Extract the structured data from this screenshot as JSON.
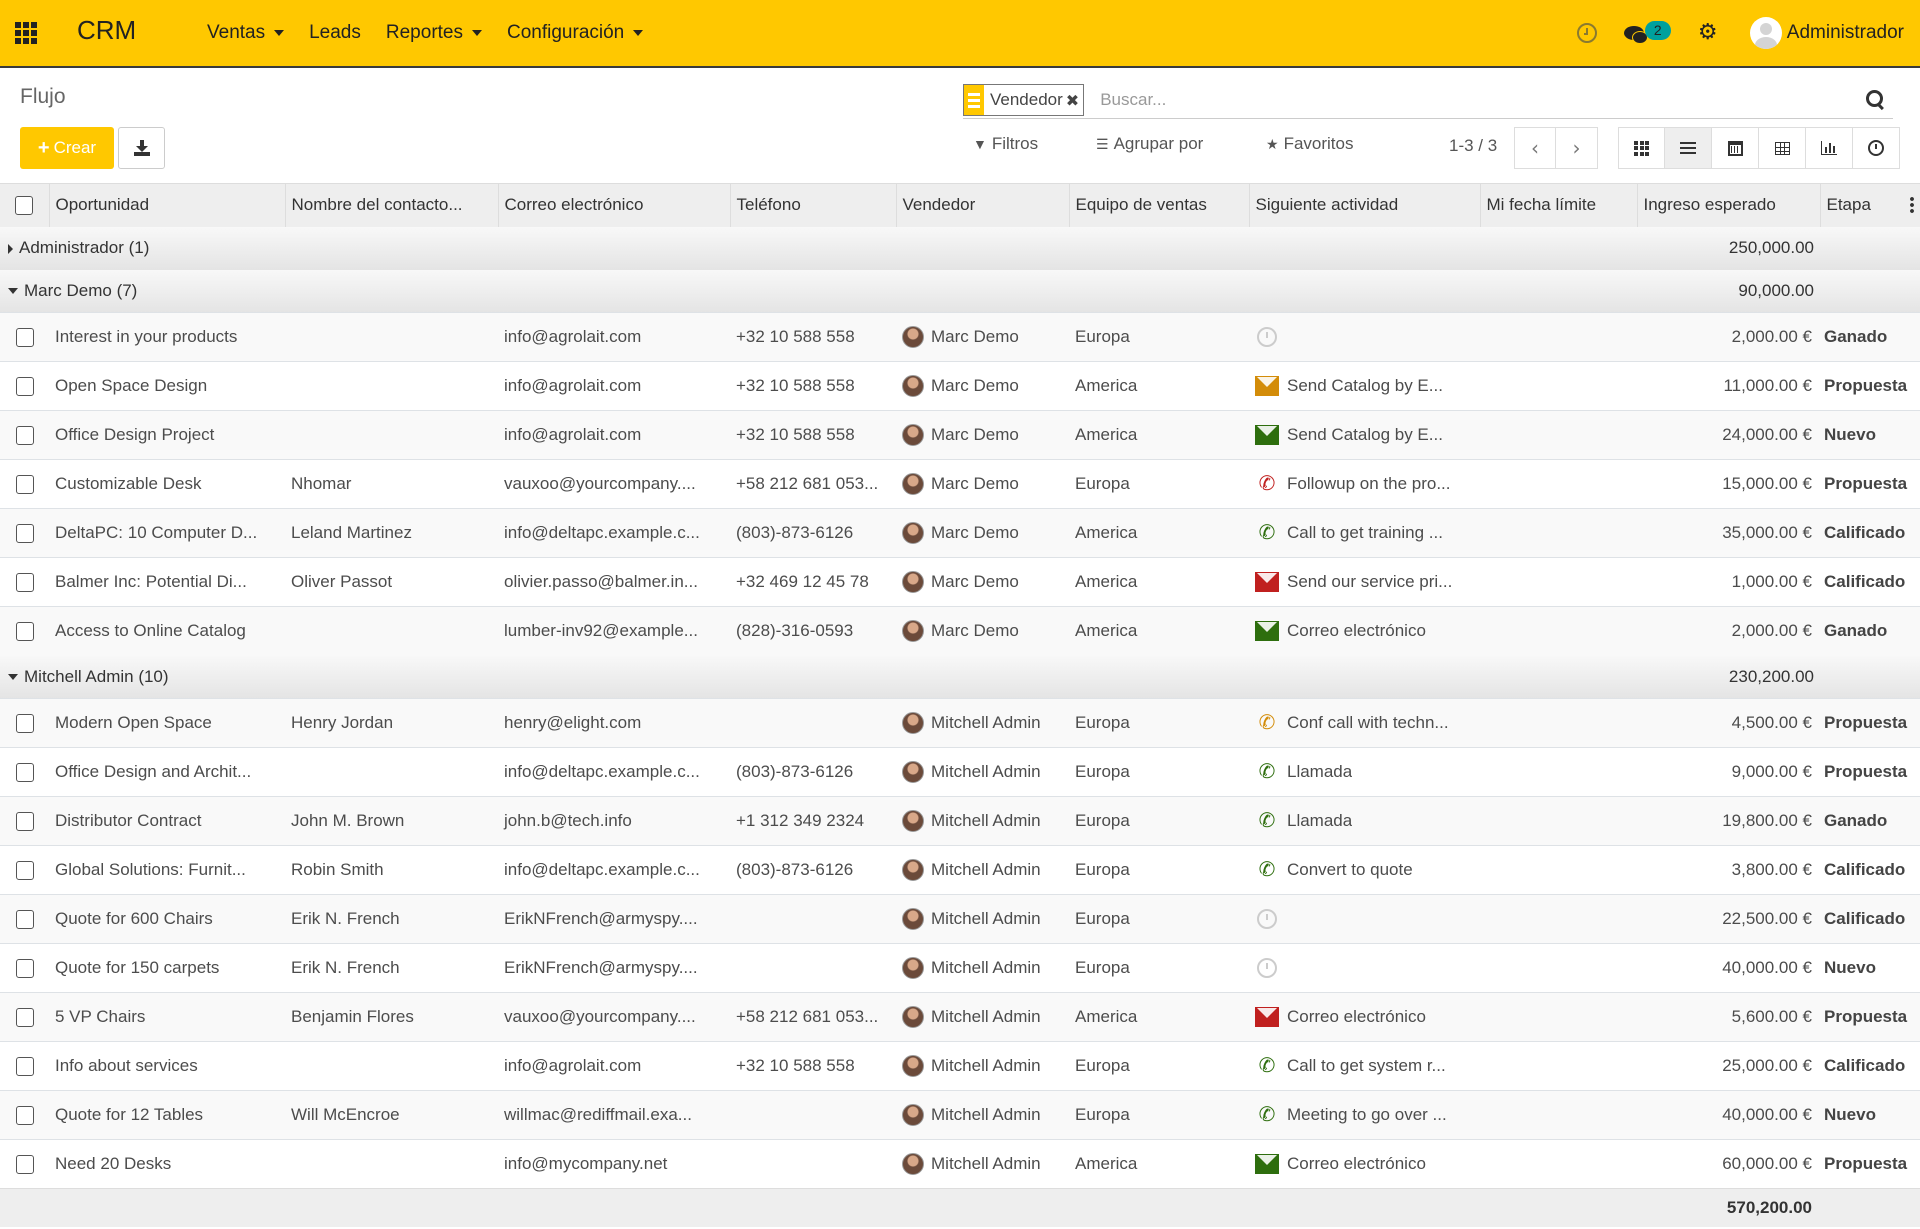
{
  "navbar": {
    "brand": "CRM",
    "menu": [
      {
        "label": "Ventas",
        "dropdown": true
      },
      {
        "label": "Leads",
        "dropdown": false
      },
      {
        "label": "Reportes",
        "dropdown": true
      },
      {
        "label": "Configuración",
        "dropdown": true
      }
    ],
    "messages_count": "2",
    "user_name": "Administrador"
  },
  "control_panel": {
    "breadcrumb": "Flujo",
    "create_label": "Crear",
    "search": {
      "facet_label": "Vendedor",
      "placeholder": "Buscar..."
    },
    "filters_label": "Filtros",
    "groupby_label": "Agrupar por",
    "favorites_label": "Favoritos",
    "pager": "1-3 / 3",
    "active_view": "list"
  },
  "colors": {
    "brand": "#ffc800",
    "email_overdue": "#c0201f",
    "email_planned": "#2e6e0e",
    "email_today": "#d38c09",
    "phone_overdue": "#c0201f",
    "phone_planned": "#2e6e0e",
    "phone_today": "#d38c09"
  },
  "table": {
    "columns": [
      "Oportunidad",
      "Nombre del contacto...",
      "Correo electrónico",
      "Teléfono",
      "Vendedor",
      "Equipo de ventas",
      "Siguiente actividad",
      "Mi fecha límite",
      "Ingreso esperado",
      "Etapa"
    ],
    "groups": [
      {
        "name": "Administrador (1)",
        "expanded": false,
        "total": "250,000.00",
        "rows": []
      },
      {
        "name": "Marc Demo (7)",
        "expanded": true,
        "total": "90,000.00",
        "rows": [
          {
            "opportunity": "Interest in your products",
            "contact": "",
            "email": "info@agrolait.com",
            "phone": "+32 10 588 558",
            "salesperson": "Marc Demo",
            "team": "Europa",
            "activity_type": "none",
            "activity_state": "",
            "activity": "",
            "deadline": "",
            "revenue": "2,000.00 €",
            "stage": "Ganado"
          },
          {
            "opportunity": "Open Space Design",
            "contact": "",
            "email": "info@agrolait.com",
            "phone": "+32 10 588 558",
            "salesperson": "Marc Demo",
            "team": "America",
            "activity_type": "email",
            "activity_state": "today",
            "activity": "Send Catalog by E...",
            "deadline": "",
            "revenue": "11,000.00 €",
            "stage": "Propuesta"
          },
          {
            "opportunity": "Office Design Project",
            "contact": "",
            "email": "info@agrolait.com",
            "phone": "+32 10 588 558",
            "salesperson": "Marc Demo",
            "team": "America",
            "activity_type": "email",
            "activity_state": "planned",
            "activity": "Send Catalog by E...",
            "deadline": "",
            "revenue": "24,000.00 €",
            "stage": "Nuevo"
          },
          {
            "opportunity": "Customizable Desk",
            "contact": "Nhomar",
            "email": "vauxoo@yourcompany....",
            "phone": "+58 212 681 053...",
            "salesperson": "Marc Demo",
            "team": "Europa",
            "activity_type": "phone",
            "activity_state": "overdue",
            "activity": "Followup on the pro...",
            "deadline": "",
            "revenue": "15,000.00 €",
            "stage": "Propuesta"
          },
          {
            "opportunity": "DeltaPC: 10 Computer D...",
            "contact": "Leland Martinez",
            "email": "info@deltapc.example.c...",
            "phone": "(803)-873-6126",
            "salesperson": "Marc Demo",
            "team": "America",
            "activity_type": "phone",
            "activity_state": "planned",
            "activity": "Call to get training ...",
            "deadline": "",
            "revenue": "35,000.00 €",
            "stage": "Calificado"
          },
          {
            "opportunity": "Balmer Inc: Potential Di...",
            "contact": "Oliver Passot",
            "email": "olivier.passo@balmer.in...",
            "phone": "+32 469 12 45 78",
            "salesperson": "Marc Demo",
            "team": "America",
            "activity_type": "email",
            "activity_state": "overdue",
            "activity": "Send our service pri...",
            "deadline": "",
            "revenue": "1,000.00 €",
            "stage": "Calificado"
          },
          {
            "opportunity": "Access to Online Catalog",
            "contact": "",
            "email": "lumber-inv92@example...",
            "phone": "(828)-316-0593",
            "salesperson": "Marc Demo",
            "team": "America",
            "activity_type": "email",
            "activity_state": "planned",
            "activity": "Correo electrónico",
            "deadline": "",
            "revenue": "2,000.00 €",
            "stage": "Ganado"
          }
        ]
      },
      {
        "name": "Mitchell Admin (10)",
        "expanded": true,
        "total": "230,200.00",
        "rows": [
          {
            "opportunity": "Modern Open Space",
            "contact": "Henry Jordan",
            "email": "henry@elight.com",
            "phone": "",
            "salesperson": "Mitchell Admin",
            "team": "Europa",
            "activity_type": "phone",
            "activity_state": "today",
            "activity": "Conf call with techn...",
            "deadline": "",
            "revenue": "4,500.00 €",
            "stage": "Propuesta"
          },
          {
            "opportunity": "Office Design and Archit...",
            "contact": "",
            "email": "info@deltapc.example.c...",
            "phone": "(803)-873-6126",
            "salesperson": "Mitchell Admin",
            "team": "Europa",
            "activity_type": "phone",
            "activity_state": "planned",
            "activity": "Llamada",
            "deadline": "",
            "revenue": "9,000.00 €",
            "stage": "Propuesta"
          },
          {
            "opportunity": "Distributor Contract",
            "contact": "John M. Brown",
            "email": "john.b@tech.info",
            "phone": "+1 312 349 2324",
            "salesperson": "Mitchell Admin",
            "team": "Europa",
            "activity_type": "phone",
            "activity_state": "planned",
            "activity": "Llamada",
            "deadline": "",
            "revenue": "19,800.00 €",
            "stage": "Ganado"
          },
          {
            "opportunity": "Global Solutions: Furnit...",
            "contact": "Robin Smith",
            "email": "info@deltapc.example.c...",
            "phone": "(803)-873-6126",
            "salesperson": "Mitchell Admin",
            "team": "Europa",
            "activity_type": "phone",
            "activity_state": "planned",
            "activity": "Convert to quote",
            "deadline": "",
            "revenue": "3,800.00 €",
            "stage": "Calificado"
          },
          {
            "opportunity": "Quote for 600 Chairs",
            "contact": "Erik N. French",
            "email": "ErikNFrench@armyspy....",
            "phone": "",
            "salesperson": "Mitchell Admin",
            "team": "Europa",
            "activity_type": "none",
            "activity_state": "",
            "activity": "",
            "deadline": "",
            "revenue": "22,500.00 €",
            "stage": "Calificado"
          },
          {
            "opportunity": "Quote for 150 carpets",
            "contact": "Erik N. French",
            "email": "ErikNFrench@armyspy....",
            "phone": "",
            "salesperson": "Mitchell Admin",
            "team": "Europa",
            "activity_type": "none",
            "activity_state": "",
            "activity": "",
            "deadline": "",
            "revenue": "40,000.00 €",
            "stage": "Nuevo"
          },
          {
            "opportunity": "5 VP Chairs",
            "contact": "Benjamin Flores",
            "email": "vauxoo@yourcompany....",
            "phone": "+58 212 681 053...",
            "salesperson": "Mitchell Admin",
            "team": "America",
            "activity_type": "email",
            "activity_state": "overdue",
            "activity": "Correo electrónico",
            "deadline": "",
            "revenue": "5,600.00 €",
            "stage": "Propuesta"
          },
          {
            "opportunity": "Info about services",
            "contact": "",
            "email": "info@agrolait.com",
            "phone": "+32 10 588 558",
            "salesperson": "Mitchell Admin",
            "team": "Europa",
            "activity_type": "phone",
            "activity_state": "planned",
            "activity": "Call to get system r...",
            "deadline": "",
            "revenue": "25,000.00 €",
            "stage": "Calificado"
          },
          {
            "opportunity": "Quote for 12 Tables",
            "contact": "Will McEncroe",
            "email": "willmac@rediffmail.exa...",
            "phone": "",
            "salesperson": "Mitchell Admin",
            "team": "Europa",
            "activity_type": "phone",
            "activity_state": "planned",
            "activity": "Meeting to go over ...",
            "deadline": "",
            "revenue": "40,000.00 €",
            "stage": "Nuevo"
          },
          {
            "opportunity": "Need 20 Desks",
            "contact": "",
            "email": "info@mycompany.net",
            "phone": "",
            "salesperson": "Mitchell Admin",
            "team": "America",
            "activity_type": "email",
            "activity_state": "planned",
            "activity": "Correo electrónico",
            "deadline": "",
            "revenue": "60,000.00 €",
            "stage": "Propuesta"
          }
        ]
      }
    ],
    "grand_total": "570,200.00"
  }
}
